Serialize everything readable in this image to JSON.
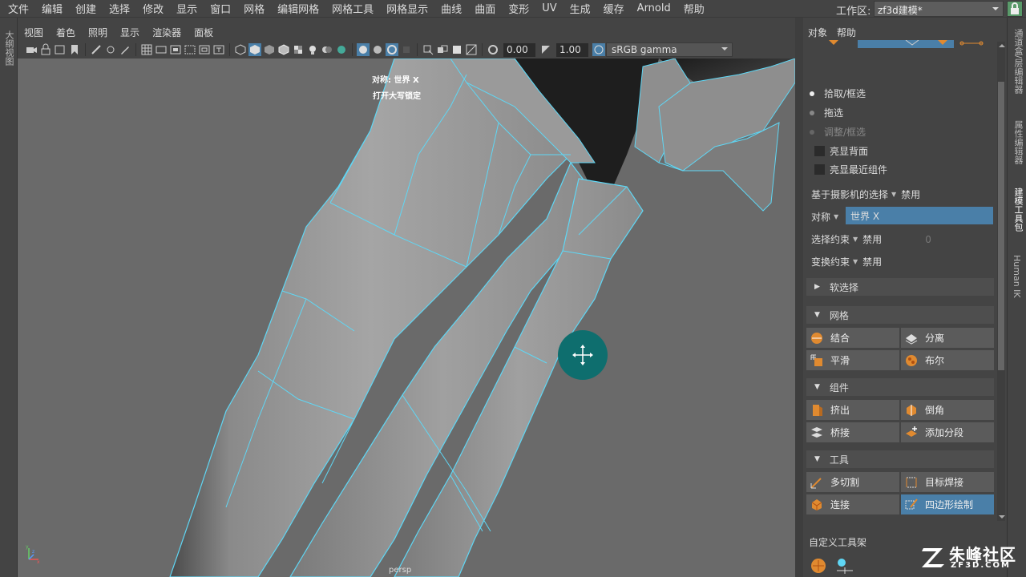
{
  "menubar": {
    "items": [
      "文件",
      "编辑",
      "创建",
      "选择",
      "修改",
      "显示",
      "窗口",
      "网格",
      "编辑网格",
      "网格工具",
      "网格显示",
      "曲线",
      "曲面",
      "变形",
      "UV",
      "生成",
      "缓存",
      "Arnold",
      "帮助"
    ],
    "workspace_label": "工作区:",
    "workspace_value": "zf3d建模*"
  },
  "left_strip": {
    "label": "大纲视图"
  },
  "panel_menu": {
    "items": [
      "视图",
      "着色",
      "照明",
      "显示",
      "渲染器",
      "面板"
    ]
  },
  "viewport_toolbar": {
    "exposure": "0.00",
    "gamma": "1.00",
    "color_space": "sRGB gamma"
  },
  "viewport": {
    "hud_symmetry": "对称: 世界 X",
    "hud_caps": "打开大写锁定",
    "camera": "persp"
  },
  "right_panel": {
    "menu": [
      "对象",
      "帮助"
    ],
    "radio": [
      "拾取/框选",
      "拖选",
      "调整/框选"
    ],
    "checks": [
      "亮显背面",
      "亮显最近组件"
    ],
    "camera_select_label": "基于摄影机的选择",
    "camera_select_value": "禁用",
    "symmetry_label": "对称",
    "symmetry_value": "世界 X",
    "select_constraint_label": "选择约束",
    "select_constraint_value": "禁用",
    "select_constraint_num": "0",
    "transform_constraint_label": "变换约束",
    "transform_constraint_value": "禁用",
    "soft_select": "软选择",
    "sections": {
      "mesh": "网格",
      "components": "组件",
      "tools": "工具"
    },
    "mesh_tools": [
      "结合",
      "分离",
      "平滑",
      "布尔"
    ],
    "component_tools": [
      "挤出",
      "倒角",
      "桥接",
      "添加分段"
    ],
    "tool_tools": [
      "多切割",
      "目标焊接",
      "连接",
      "四边形绘制"
    ],
    "custom_shelf": "自定义工具架"
  },
  "vtabs": [
    "通道盒/层编辑器",
    "属性编辑器",
    "建模工具包",
    "Human IK"
  ],
  "watermark": {
    "main": "朱峰社区",
    "sub": "ZF3D.COM"
  },
  "colors": {
    "accent": "#4a7fa8",
    "wire": "#5fd7f5",
    "cursor": "#0e6e6e"
  }
}
